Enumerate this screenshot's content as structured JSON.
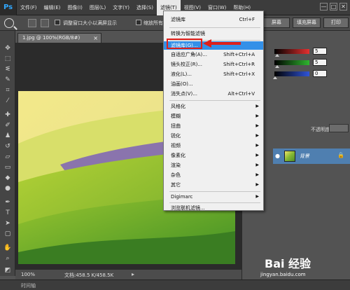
{
  "menubar": {
    "logo": "Ps",
    "items": [
      "文件(F)",
      "编辑(E)",
      "图像(I)",
      "图层(L)",
      "文字(Y)",
      "选择(S)",
      "滤镜(T)",
      "视图(V)",
      "窗口(W)",
      "帮助(H)"
    ],
    "window_controls": [
      "—",
      "□",
      "✕"
    ]
  },
  "options": {
    "resize_label": "调整窗口大小以满屏显示",
    "zoom_all_label": "缩放所有",
    "buttons": [
      "屏幕",
      "填充屏幕",
      "打印"
    ]
  },
  "document": {
    "tab_title": "1.jpg @ 100%(RGB/8#)",
    "tab_close": "×",
    "zoom": "100%",
    "doc_info": "文档:458.5 K/458.5K",
    "status_arrow": "▸"
  },
  "bottom_panel_label": "时间轴",
  "color_panel": {
    "values": [
      "5",
      "5",
      "0"
    ],
    "colors": [
      "#e53030",
      "#2fb52f",
      "#2f54d8"
    ]
  },
  "layers": {
    "opacity_label": "不透明度:",
    "layer_name": "背景",
    "lock_icon": "🔒"
  },
  "filter_menu": {
    "items": [
      {
        "label": "滤镜库",
        "shortcut": "Ctrl+F"
      },
      {
        "label": "转换为智能滤镜",
        "shortcut": ""
      },
      {
        "label": "滤镜库(G)...",
        "shortcut": ""
      },
      {
        "label": "自适应广角(A)...",
        "shortcut": "Shift+Ctrl+A"
      },
      {
        "label": "镜头校正(R)...",
        "shortcut": "Shift+Ctrl+R"
      },
      {
        "label": "液化(L)...",
        "shortcut": "Shift+Ctrl+X"
      },
      {
        "label": "油画(O)...",
        "shortcut": ""
      },
      {
        "label": "消失点(V)...",
        "shortcut": "Alt+Ctrl+V"
      },
      {
        "label": "风格化",
        "shortcut": ""
      },
      {
        "label": "模糊",
        "shortcut": ""
      },
      {
        "label": "扭曲",
        "shortcut": ""
      },
      {
        "label": "锐化",
        "shortcut": ""
      },
      {
        "label": "视频",
        "shortcut": ""
      },
      {
        "label": "像素化",
        "shortcut": ""
      },
      {
        "label": "渲染",
        "shortcut": ""
      },
      {
        "label": "杂色",
        "shortcut": ""
      },
      {
        "label": "其它",
        "shortcut": ""
      },
      {
        "label": "Digimarc",
        "shortcut": ""
      },
      {
        "label": "浏览联机滤镜...",
        "shortcut": ""
      }
    ],
    "submenu_arrow": "▶"
  },
  "watermark": {
    "logo": "Bai 经验",
    "url": "jingyan.baidu.com"
  }
}
